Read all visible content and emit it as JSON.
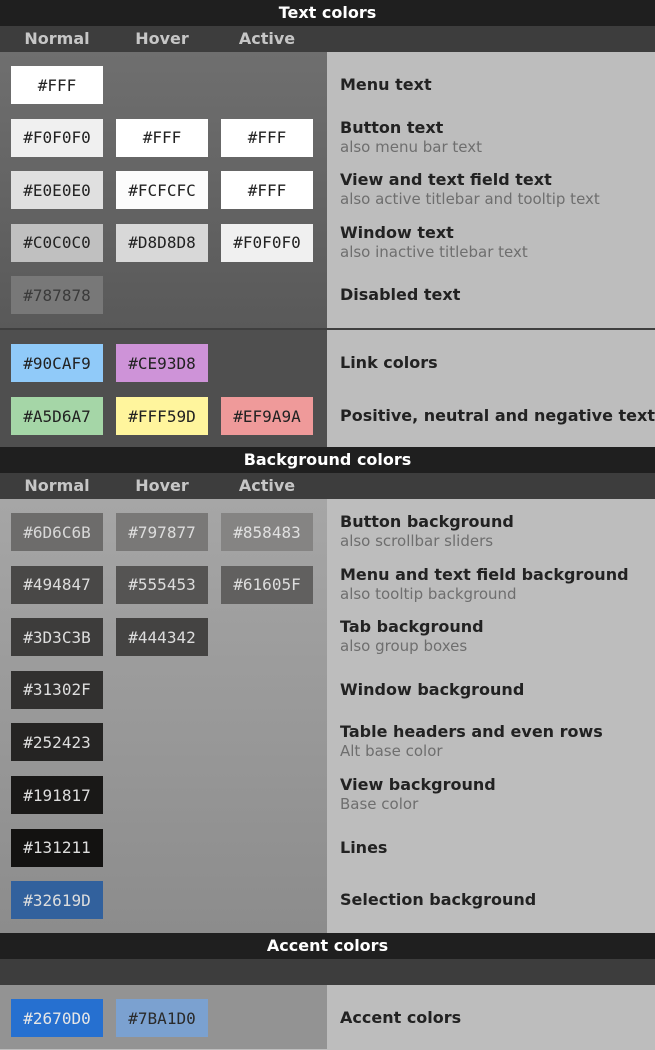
{
  "sections": {
    "text_colors": "Text colors",
    "background_colors": "Background colors",
    "accent_colors": "Accent colors"
  },
  "columns": {
    "normal": "Normal",
    "hover": "Hover",
    "active": "Active"
  },
  "text_rows": [
    {
      "label": "Menu text",
      "sub": "",
      "swatches": [
        {
          "value": "#FFF",
          "bg": "#FFFFFF",
          "fg": "#222222"
        }
      ]
    },
    {
      "label": "Button text",
      "sub": "also menu bar text",
      "swatches": [
        {
          "value": "#F0F0F0",
          "bg": "#F0F0F0",
          "fg": "#222222"
        },
        {
          "value": "#FFF",
          "bg": "#FFFFFF",
          "fg": "#222222"
        },
        {
          "value": "#FFF",
          "bg": "#FFFFFF",
          "fg": "#222222"
        }
      ]
    },
    {
      "label": "View and text field text",
      "sub": "also active titlebar and tooltip text",
      "swatches": [
        {
          "value": "#E0E0E0",
          "bg": "#E0E0E0",
          "fg": "#222222"
        },
        {
          "value": "#FCFCFC",
          "bg": "#FCFCFC",
          "fg": "#222222"
        },
        {
          "value": "#FFF",
          "bg": "#FFFFFF",
          "fg": "#222222"
        }
      ]
    },
    {
      "label": "Window text",
      "sub": "also inactive titlebar text",
      "swatches": [
        {
          "value": "#C0C0C0",
          "bg": "#C0C0C0",
          "fg": "#222222"
        },
        {
          "value": "#D8D8D8",
          "bg": "#D8D8D8",
          "fg": "#222222"
        },
        {
          "value": "#F0F0F0",
          "bg": "#F0F0F0",
          "fg": "#222222"
        }
      ]
    },
    {
      "label": "Disabled text",
      "sub": "",
      "swatches": [
        {
          "value": "#787878",
          "bg": "#787878",
          "fg": "#3a3a3a"
        }
      ]
    }
  ],
  "link_rows": [
    {
      "label": "Link colors",
      "sub": "",
      "swatches": [
        {
          "value": "#90CAF9",
          "bg": "#90CAF9",
          "fg": "#222222"
        },
        {
          "value": "#CE93D8",
          "bg": "#CE93D8",
          "fg": "#222222"
        }
      ]
    },
    {
      "label": "Positive, neutral and negative text",
      "sub": "",
      "swatches": [
        {
          "value": "#A5D6A7",
          "bg": "#A5D6A7",
          "fg": "#222222"
        },
        {
          "value": "#FFF59D",
          "bg": "#FFF59D",
          "fg": "#222222"
        },
        {
          "value": "#EF9A9A",
          "bg": "#EF9A9A",
          "fg": "#222222"
        }
      ]
    }
  ],
  "bg_rows": [
    {
      "label": "Button background",
      "sub": "also scrollbar sliders",
      "swatches": [
        {
          "value": "#6D6C6B",
          "bg": "#6D6C6B",
          "fg": "#d8d8d8"
        },
        {
          "value": "#797877",
          "bg": "#797877",
          "fg": "#dddddd"
        },
        {
          "value": "#858483",
          "bg": "#858483",
          "fg": "#e0e0e0"
        }
      ]
    },
    {
      "label": "Menu and text field background",
      "sub": "also tooltip background",
      "swatches": [
        {
          "value": "#494847",
          "bg": "#494847",
          "fg": "#dddddd"
        },
        {
          "value": "#555453",
          "bg": "#555453",
          "fg": "#dddddd"
        },
        {
          "value": "#61605F",
          "bg": "#61605F",
          "fg": "#dddddd"
        }
      ]
    },
    {
      "label": "Tab background",
      "sub": "also group boxes",
      "swatches": [
        {
          "value": "#3D3C3B",
          "bg": "#3D3C3B",
          "fg": "#dddddd"
        },
        {
          "value": "#444342",
          "bg": "#444342",
          "fg": "#dddddd"
        }
      ]
    },
    {
      "label": "Window background",
      "sub": "",
      "swatches": [
        {
          "value": "#31302F",
          "bg": "#31302F",
          "fg": "#dddddd"
        }
      ]
    },
    {
      "label": "Table headers and even rows",
      "sub": "Alt base color",
      "swatches": [
        {
          "value": "#252423",
          "bg": "#252423",
          "fg": "#dddddd"
        }
      ]
    },
    {
      "label": "View background",
      "sub": "Base color",
      "swatches": [
        {
          "value": "#191817",
          "bg": "#191817",
          "fg": "#dddddd"
        }
      ]
    },
    {
      "label": "Lines",
      "sub": "",
      "swatches": [
        {
          "value": "#131211",
          "bg": "#131211",
          "fg": "#dddddd"
        }
      ]
    },
    {
      "label": "Selection background",
      "sub": "",
      "swatches": [
        {
          "value": "#32619D",
          "bg": "#32619D",
          "fg": "#dddddd"
        }
      ]
    }
  ],
  "accent_rows": [
    {
      "label": "Accent colors",
      "sub": "",
      "swatches": [
        {
          "value": "#2670D0",
          "bg": "#2670D0",
          "fg": "#e6e6e6"
        },
        {
          "value": "#7BA1D0",
          "bg": "#7BA1D0",
          "fg": "#2a2a2a"
        }
      ]
    }
  ]
}
